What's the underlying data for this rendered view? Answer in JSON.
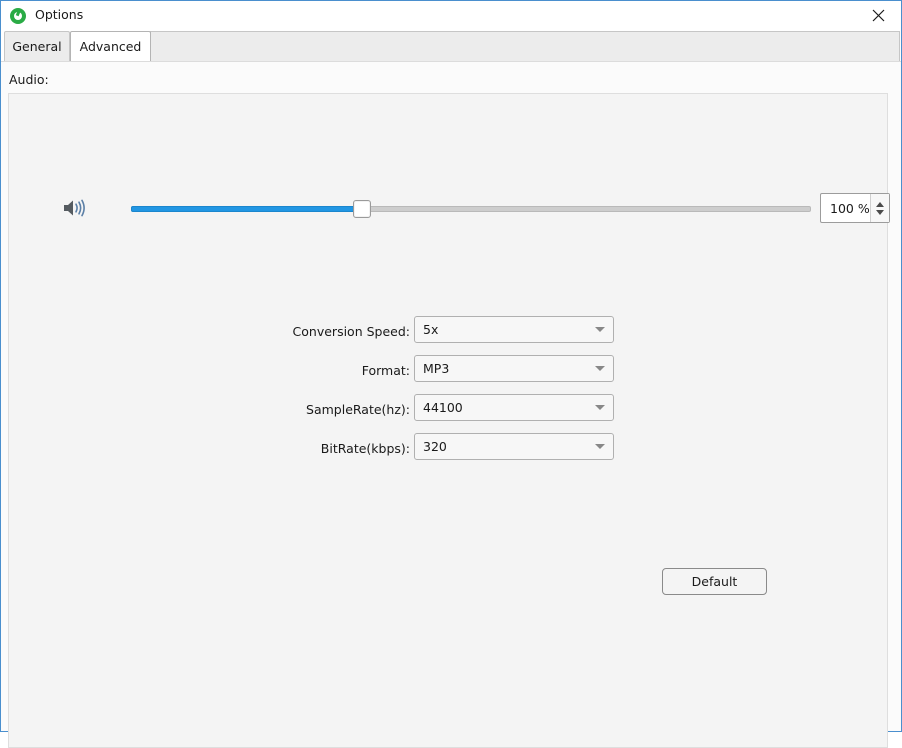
{
  "window": {
    "title": "Options",
    "app_icon": "green-circle-logo-icon",
    "close_icon": "close-icon",
    "border_color": "#4a8fce"
  },
  "tabs": [
    {
      "label": "General",
      "selected": false
    },
    {
      "label": "Advanced",
      "selected": true
    }
  ],
  "section": {
    "label": "Audio:"
  },
  "volume": {
    "speaker_icon": "speaker-volume-icon",
    "value": 100,
    "display_value": "100 %",
    "min": 0,
    "max": 200,
    "fill_color": "#2196e3",
    "track_color": "#cdcdcd",
    "spinner_up_icon": "chevron-up-icon",
    "spinner_down_icon": "chevron-down-icon"
  },
  "fields": [
    {
      "label": "Conversion Speed:",
      "value": "5x",
      "arrow_icon": "chevron-down-icon"
    },
    {
      "label": "Format:",
      "value": "MP3",
      "arrow_icon": "chevron-down-icon"
    },
    {
      "label": "SampleRate(hz):",
      "value": "44100",
      "arrow_icon": "chevron-down-icon"
    },
    {
      "label": "BitRate(kbps):",
      "value": "320",
      "arrow_icon": "chevron-down-icon"
    }
  ],
  "actions": {
    "default_label": "Default"
  }
}
